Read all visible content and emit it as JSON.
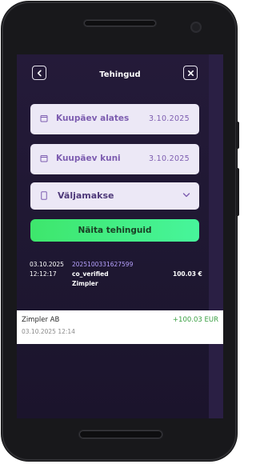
{
  "header": {
    "title": "Tehingud"
  },
  "filters": {
    "date_from": {
      "label": "Kuupäev alates",
      "value": "3.10.2025"
    },
    "date_to": {
      "label": "Kuupäev kuni",
      "value": "3.10.2025"
    },
    "type_select": {
      "value": "Väljamakse"
    }
  },
  "show_button": {
    "label": "Näita tehinguid"
  },
  "transaction": {
    "date": "03.10.2025",
    "time": "12:12:17",
    "id": "2025100331627599",
    "status": "co_verified",
    "merchant": "Zimpler",
    "amount": "100.03 €"
  },
  "receipt": {
    "name": "Zimpler AB",
    "datetime": "03.10.2025 12:14",
    "amount": "+100.03 EUR"
  },
  "colors": {
    "background": "#241a39",
    "accent_green": "#3ee66c",
    "field_bg": "#ece8f6",
    "field_text": "#7d5db0"
  }
}
